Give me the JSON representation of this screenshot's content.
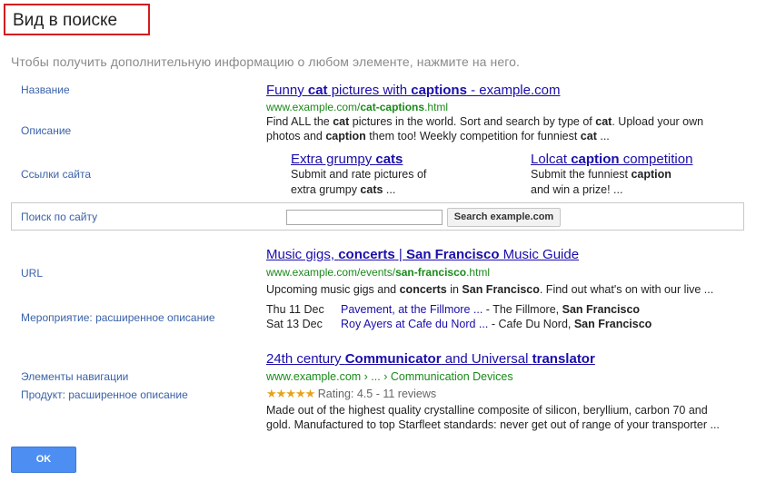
{
  "dialog": {
    "title": "Вид в поиске",
    "subtitle": "Чтобы получить дополнительную информацию о любом элементе, нажмите на него.",
    "ok_label": "OK"
  },
  "labels": {
    "name": "Название",
    "description": "Описание",
    "sitelinks": "Ссылки сайта",
    "site_search": "Поиск по сайту",
    "url": "URL",
    "event_rich": "Мероприятие: расширенное описание",
    "breadcrumbs": "Элементы навигации",
    "product_rich": "Продукт: расширенное описание"
  },
  "result1": {
    "title_parts": [
      "Funny ",
      "cat",
      " pictures with ",
      "captions",
      " - example.com"
    ],
    "url_parts": [
      "www.example.com/",
      "cat-captions",
      ".html"
    ],
    "snippet_line1_parts": [
      "Find ALL the ",
      "cat",
      " pictures in the world. Sort and search by type of ",
      "cat",
      ". Upload your own"
    ],
    "snippet_line2_parts": [
      "photos and ",
      "caption",
      " them too! Weekly competition for funniest ",
      "cat",
      " ..."
    ],
    "sitelink1": {
      "title_parts": [
        "Extra grumpy ",
        "cats"
      ],
      "line1": "Submit and rate pictures of",
      "line2_parts": [
        "extra grumpy ",
        "cats",
        " ..."
      ]
    },
    "sitelink2": {
      "title_parts": [
        "Lolcat ",
        "caption",
        " competition"
      ],
      "line1_parts": [
        "Submit the funniest ",
        "caption"
      ],
      "line2": "and win a prize! ..."
    },
    "search_placeholder": "",
    "search_button": "Search example.com"
  },
  "result2": {
    "title_parts": [
      "Music gigs, ",
      "concerts",
      " | ",
      "San Francisco",
      " Music Guide"
    ],
    "url_parts": [
      "www.example.com/events/",
      "san-francisco",
      ".html"
    ],
    "snippet_parts": [
      "Upcoming music gigs and ",
      "concerts",
      " in ",
      "San Francisco",
      ". Find out what's on with our live ..."
    ],
    "events": [
      {
        "date": "Thu 11 Dec",
        "name": "Pavement, at the Fillmore ...",
        "venue_prefix": " - The Fillmore, ",
        "venue_bold": "San Francisco"
      },
      {
        "date": "Sat 13 Dec",
        "name": "Roy Ayers at Cafe du Nord ...",
        "venue_prefix": " - Cafe Du Nord, ",
        "venue_bold": "San Francisco"
      }
    ]
  },
  "result3": {
    "title_parts": [
      "24th century ",
      "Communicator",
      " and Universal ",
      "translator"
    ],
    "breadcrumb": "www.example.com › ... › Communication Devices",
    "stars": "★★★★★",
    "rating_text": "Rating: 4.5 - 11 reviews",
    "snippet_line1": "Made out of the highest quality crystalline composite of silicon, beryllium, carbon 70 and",
    "snippet_line2": "gold. Manufactured to top Starfleet standards: never get out of range of your transporter ..."
  },
  "colors": {
    "link": "#1a0dab",
    "url_green": "#1a8a1a",
    "label_blue": "#3a62a8",
    "title_border_red": "#d21e1e",
    "ok_button": "#4d8ef2",
    "stars": "#e7a21a"
  }
}
